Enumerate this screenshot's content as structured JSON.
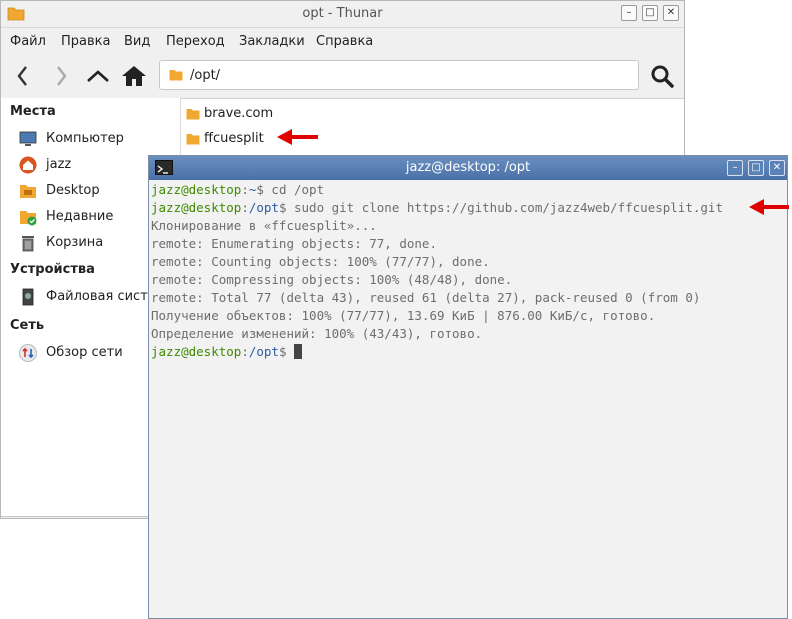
{
  "thunar": {
    "title": "opt - Thunar",
    "menu": [
      "Файл",
      "Правка",
      "Вид",
      "Переход",
      "Закладки",
      "Справка"
    ],
    "address": "/opt/",
    "sidebar": {
      "places_header": "Места",
      "places": [
        {
          "label": "Компьютер",
          "icon": "computer-icon"
        },
        {
          "label": "jazz",
          "icon": "home-icon"
        },
        {
          "label": "Desktop",
          "icon": "desktop-folder-icon"
        },
        {
          "label": "Недавние",
          "icon": "recent-icon"
        },
        {
          "label": "Корзина",
          "icon": "trash-icon"
        }
      ],
      "devices_header": "Устройства",
      "devices": [
        {
          "label": "Файловая систе",
          "icon": "drive-icon"
        }
      ],
      "network_header": "Сеть",
      "network": [
        {
          "label": "Обзор сети",
          "icon": "network-icon"
        }
      ]
    },
    "files": [
      {
        "name": "brave.com"
      },
      {
        "name": "ffcuesplit"
      }
    ]
  },
  "terminal": {
    "title": "jazz@desktop: /opt",
    "lines": [
      {
        "user": "jazz@desktop",
        "sep": ":",
        "path": "~",
        "cmd": "$ cd /opt"
      },
      {
        "user": "jazz@desktop",
        "sep": ":",
        "path": "/opt",
        "cmd": "$ sudo git clone https://github.com/jazz4web/ffcuesplit.git"
      },
      {
        "text": "Клонирование в «ffcuesplit»..."
      },
      {
        "text": "remote: Enumerating objects: 77, done."
      },
      {
        "text": "remote: Counting objects: 100% (77/77), done."
      },
      {
        "text": "remote: Compressing objects: 100% (48/48), done."
      },
      {
        "text": "remote: Total 77 (delta 43), reused 61 (delta 27), pack-reused 0 (from 0)"
      },
      {
        "text": "Получение объектов: 100% (77/77), 13.69 КиБ | 876.00 КиБ/с, готово."
      },
      {
        "text": "Определение изменений: 100% (43/43), готово."
      },
      {
        "user": "jazz@desktop",
        "sep": ":",
        "path": "/opt",
        "cmd": "$ "
      }
    ]
  },
  "colors": {
    "terminal_title_bg": "#5a80b4",
    "prompt_user": "#3f8a00",
    "prompt_path": "#2a5fa8",
    "annotation_arrow": "#e00000",
    "folder": "#f0a830"
  }
}
